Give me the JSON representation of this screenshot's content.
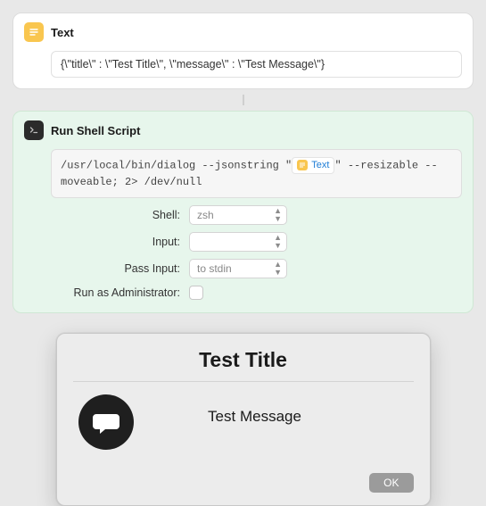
{
  "textAction": {
    "title": "Text",
    "value": "{\\\"title\\\" : \\\"Test Title\\\", \\\"message\\\" : \\\"Test Message\\\"}"
  },
  "shellAction": {
    "title": "Run Shell Script",
    "script_pre": "/usr/local/bin/dialog --jsonstring \"",
    "token_label": "Text",
    "script_post": "\" --resizable --moveable; 2> /dev/null",
    "fields": {
      "shell_label": "Shell:",
      "shell_value": "zsh",
      "input_label": "Input:",
      "input_value": "",
      "passinput_label": "Pass Input:",
      "passinput_value": "to stdin",
      "admin_label": "Run as Administrator:"
    }
  },
  "dialog": {
    "title": "Test Title",
    "message": "Test Message",
    "ok": "OK"
  }
}
